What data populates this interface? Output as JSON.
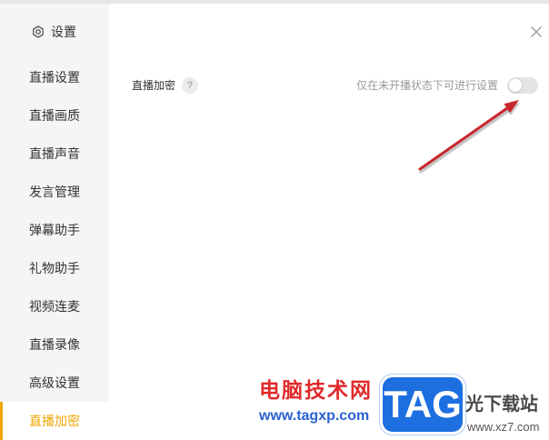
{
  "colors": {
    "accent": "#f0a500",
    "sidebar_bg": "#f4f5f7",
    "arrow": "#c8262b"
  },
  "sidebar": {
    "header": {
      "icon": "gear-icon",
      "title": "设置"
    },
    "items": [
      {
        "label": "直播设置",
        "selected": false
      },
      {
        "label": "直播画质",
        "selected": false
      },
      {
        "label": "直播声音",
        "selected": false
      },
      {
        "label": "发言管理",
        "selected": false
      },
      {
        "label": "弹幕助手",
        "selected": false
      },
      {
        "label": "礼物助手",
        "selected": false
      },
      {
        "label": "视频连麦",
        "selected": false
      },
      {
        "label": "直播录像",
        "selected": false
      },
      {
        "label": "高级设置",
        "selected": false
      },
      {
        "label": "直播加密",
        "selected": true
      }
    ]
  },
  "main": {
    "close_icon": "close-icon",
    "setting": {
      "label": "直播加密",
      "help_icon": "help-icon",
      "help_glyph": "?",
      "hint": "仅在未开播状态下可进行设置",
      "toggle": {
        "on": false,
        "enabled": false
      }
    }
  },
  "watermark": {
    "site_name": "电脑技术网",
    "site_url": "www.tagxp.com",
    "logo_text": "TAG",
    "partner_name": "光下载站",
    "partner_url": "www.xz7.com"
  }
}
